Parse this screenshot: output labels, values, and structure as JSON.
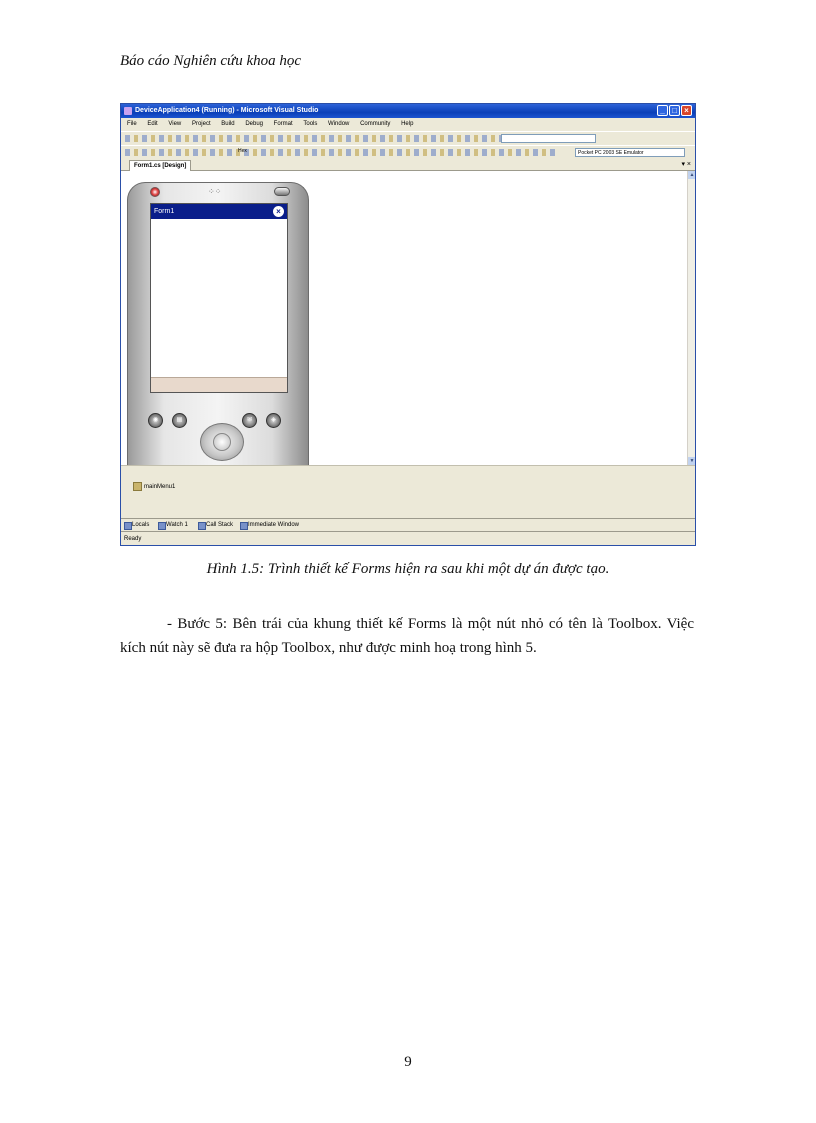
{
  "header": {
    "text": "Báo cáo Nghiên cứu khoa học"
  },
  "figure": {
    "window_title": "DeviceApplication4 (Running) - Microsoft Visual Studio",
    "menu": [
      "File",
      "Edit",
      "View",
      "Project",
      "Build",
      "Debug",
      "Format",
      "Tools",
      "Window",
      "Community",
      "Help"
    ],
    "toolbar2_combo": "Pocket PC 2003 SE Emulator",
    "toolbar2_hex": "Hex",
    "doc_tab": "Form1.cs [Design]",
    "form_title": "Form1",
    "tray_item": "mainMenu1",
    "bottom_tabs": [
      "Locals",
      "Watch 1",
      "Call Stack",
      "Immediate Window"
    ],
    "status": "Ready"
  },
  "caption": {
    "label": "Hình 1.5:",
    "text": " Trình thiết kế Forms hiện ra sau khi một dự án được tạo."
  },
  "body": {
    "paragraph": "- Bước 5: Bên trái của khung thiết kế Forms là một nút nhỏ có tên là Toolbox. Việc kích nút này sẽ đưa ra hộp Toolbox, như được minh hoạ trong hình 5."
  },
  "footer": {
    "page_number": "9"
  }
}
